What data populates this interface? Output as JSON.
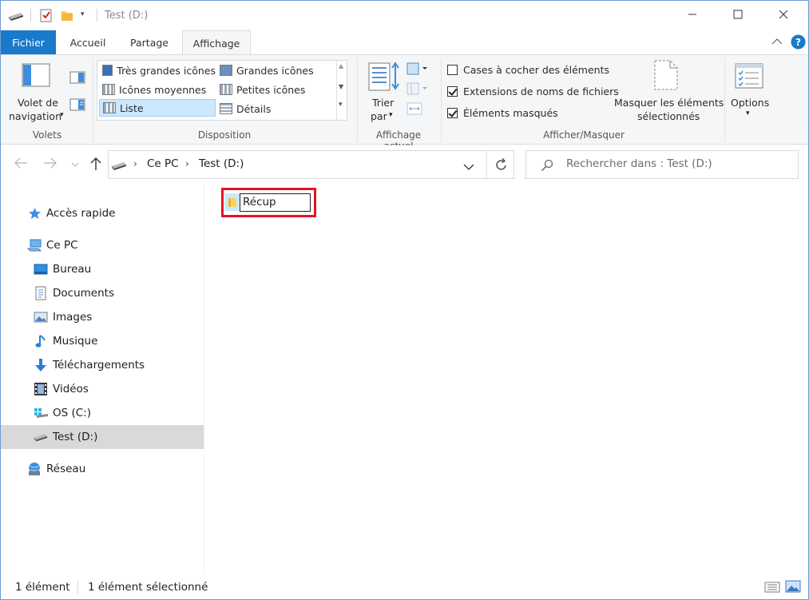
{
  "window": {
    "title": "Test (D:)",
    "controls": {
      "minimize": "minimize",
      "maximize": "maximize",
      "close": "close"
    }
  },
  "tabs": {
    "file": "Fichier",
    "home": "Accueil",
    "share": "Partage",
    "view": "Affichage"
  },
  "ribbon": {
    "panes": {
      "nav_pane_line1": "Volet de",
      "nav_pane_line2": "navigation",
      "group_label": "Volets"
    },
    "layout": {
      "items": [
        "Très grandes icônes",
        "Grandes icônes",
        "Icônes moyennes",
        "Petites icônes",
        "Liste",
        "Détails"
      ],
      "selected": "Liste",
      "group_label": "Disposition"
    },
    "current_view": {
      "sort_line1": "Trier",
      "sort_line2": "par",
      "group_label": "Affichage actuel"
    },
    "show_hide": {
      "checkbox_items": [
        {
          "label": "Cases à cocher des éléments",
          "checked": false
        },
        {
          "label": "Extensions de noms de fichiers",
          "checked": true
        },
        {
          "label": "Éléments masqués",
          "checked": true
        }
      ],
      "hide_selected_line1": "Masquer les éléments",
      "hide_selected_line2": "sélectionnés",
      "group_label": "Afficher/Masquer"
    },
    "options": {
      "label": "Options"
    }
  },
  "nav": {
    "breadcrumb": [
      "Ce PC",
      "Test (D:)"
    ],
    "search_placeholder": "Rechercher dans : Test (D:)"
  },
  "sidebar": {
    "items": [
      {
        "label": "Accès rapide",
        "icon": "star-icon"
      },
      {
        "label": "Ce PC",
        "icon": "computer-icon"
      },
      {
        "label": "Bureau",
        "icon": "desktop-icon"
      },
      {
        "label": "Documents",
        "icon": "documents-icon"
      },
      {
        "label": "Images",
        "icon": "pictures-icon"
      },
      {
        "label": "Musique",
        "icon": "music-icon"
      },
      {
        "label": "Téléchargements",
        "icon": "download-icon"
      },
      {
        "label": "Vidéos",
        "icon": "video-icon"
      },
      {
        "label": "OS (C:)",
        "icon": "windows-drive-icon"
      },
      {
        "label": "Test (D:)",
        "icon": "drive-icon",
        "selected": true
      },
      {
        "label": "Réseau",
        "icon": "network-icon"
      }
    ]
  },
  "content": {
    "items": [
      {
        "name": "Récup",
        "type": "folder",
        "renaming": true
      }
    ]
  },
  "status": {
    "count": "1 élément",
    "selection": "1 élément sélectionné"
  },
  "colors": {
    "file_tab": "#1979ca",
    "selection": "#cce8ff",
    "highlight_box": "#e81123"
  }
}
